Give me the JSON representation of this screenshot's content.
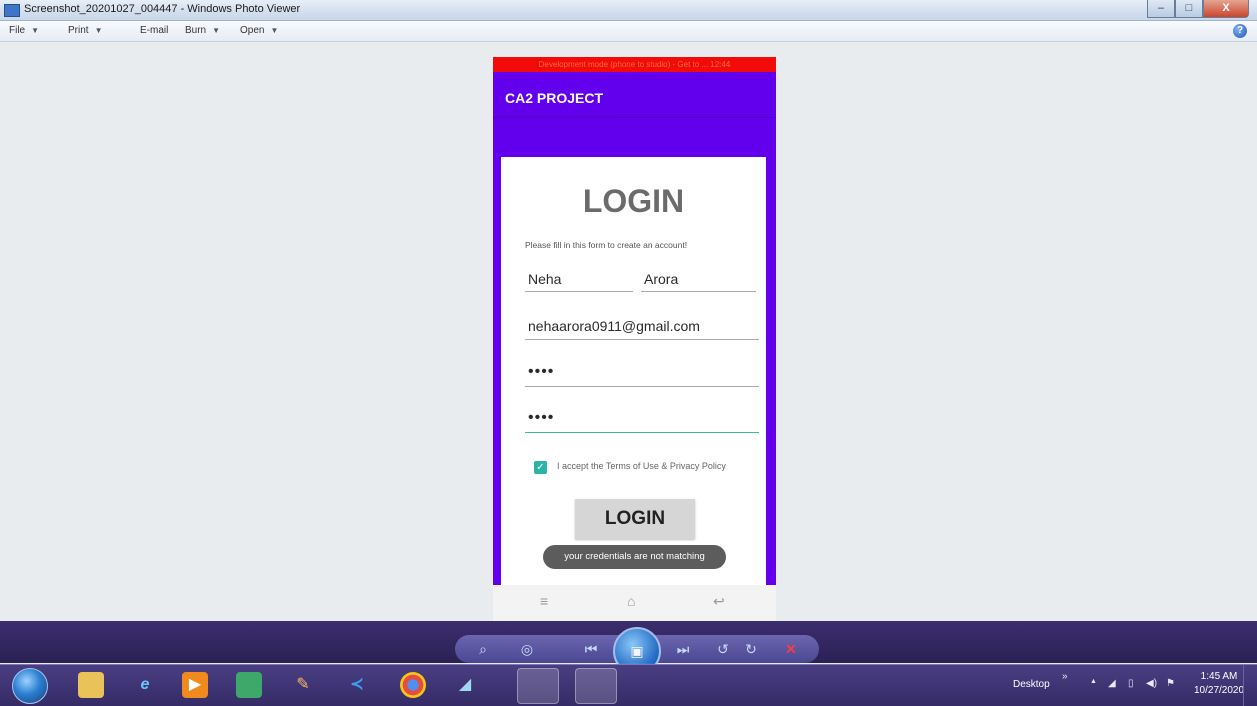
{
  "window": {
    "title": "Screenshot_20201027_004447 - Windows Photo Viewer",
    "minimize": "–",
    "maximize": "□",
    "close": "X"
  },
  "menu": {
    "items": [
      "File",
      "Print",
      "E-mail",
      "Burn",
      "Open"
    ],
    "help": "?"
  },
  "phone": {
    "dev_strip": "Development mode (phone to studio) - Get to ... 12:44",
    "app_title": "CA2 PROJECT",
    "heading": "LOGIN",
    "subtitle": "Please fill in this form to create an account!",
    "first_name": "Neha",
    "last_name": "Arora",
    "email": "nehaarora0911@gmail.com",
    "password": "••••",
    "confirm_password": "••••",
    "terms_checked": true,
    "terms_label": "I accept the Terms of Use & Privacy Policy",
    "login_button": "LOGIN",
    "toast": "your credentials are not matching",
    "nav": {
      "menu": "≡",
      "home": "⌂",
      "back": "↩"
    }
  },
  "viewer_controls": {
    "zoom": "⌕",
    "actual_size": "◎",
    "previous": "⏮",
    "slideshow": "▣",
    "next": "⏭",
    "rotate_ccw": "↺",
    "rotate_cw": "↻",
    "delete": "✕"
  },
  "taskbar": {
    "desktop_label": "Desktop",
    "chevron": "»",
    "tray_up": "▲",
    "time": "1:45 AM",
    "date": "10/27/2020"
  }
}
